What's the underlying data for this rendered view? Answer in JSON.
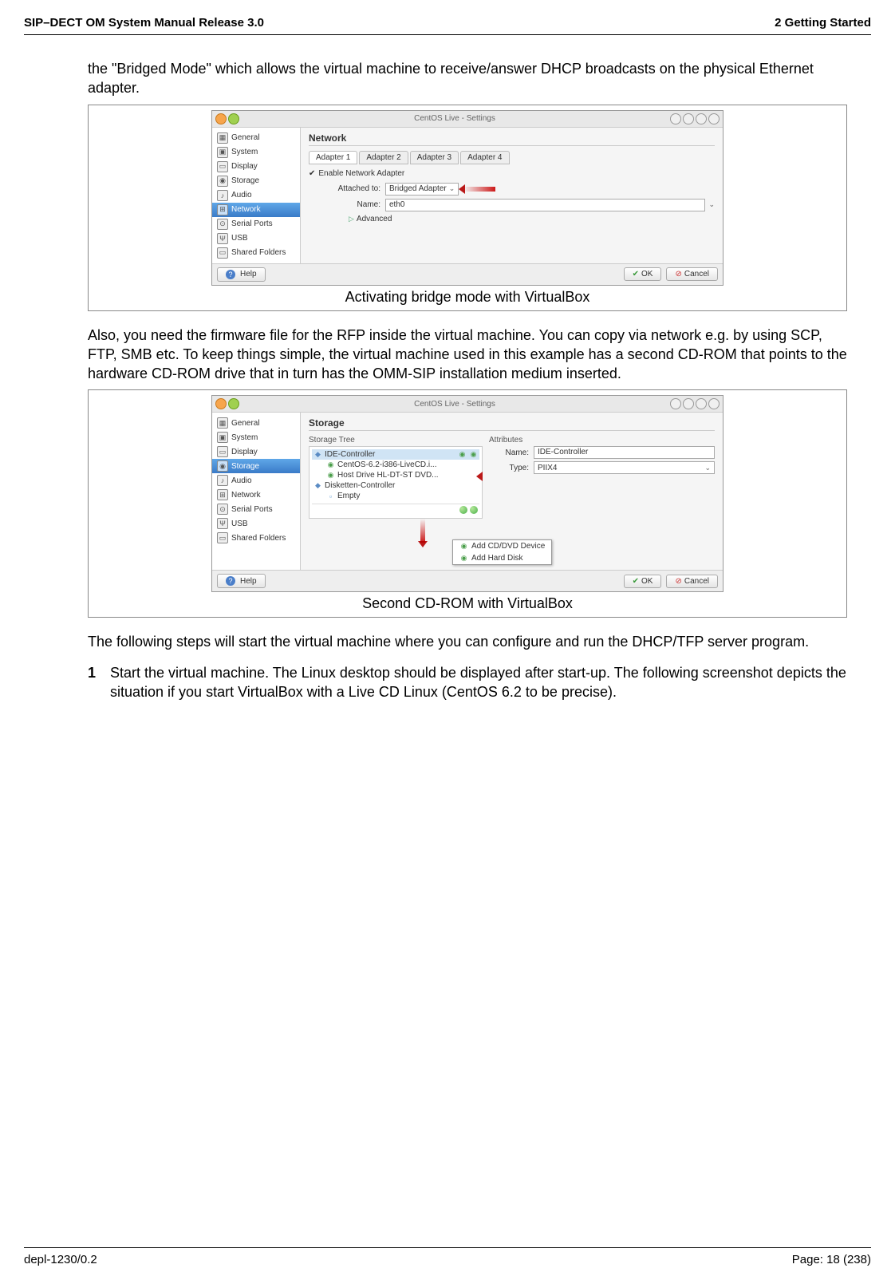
{
  "headerLeft": "SIP–DECT OM System Manual Release 3.0",
  "headerRight": "2 Getting Started",
  "para1": "the \"Bridged Mode\" which allows the virtual machine to receive/answer DHCP broadcasts on the physical Ethernet adapter.",
  "fig1": {
    "title": "CentOS Live - Settings",
    "sidebar": [
      "General",
      "System",
      "Display",
      "Storage",
      "Audio",
      "Network",
      "Serial Ports",
      "USB",
      "Shared Folders"
    ],
    "selectedIndex": 5,
    "mainTitle": "Network",
    "tabs": [
      "Adapter 1",
      "Adapter 2",
      "Adapter 3",
      "Adapter 4"
    ],
    "enableAdapter": "Enable Network Adapter",
    "attachedToLabel": "Attached to:",
    "attachedToValue": "Bridged Adapter",
    "nameLabel": "Name:",
    "nameValue": "eth0",
    "advanced": "Advanced",
    "help": "Help",
    "ok": "OK",
    "cancel": "Cancel",
    "caption": "Activating bridge mode with VirtualBox"
  },
  "para2": "Also, you need the firmware file for the RFP inside the virtual machine. You can copy via network e.g. by using SCP, FTP, SMB etc. To keep things simple, the virtual machine used in this example has a second CD-ROM that points to the hardware CD-ROM drive that in turn has the OMM-SIP installation medium inserted.",
  "fig2": {
    "title": "CentOS Live - Settings",
    "sidebar": [
      "General",
      "System",
      "Display",
      "Storage",
      "Audio",
      "Network",
      "Serial Ports",
      "USB",
      "Shared Folders"
    ],
    "selectedIndex": 3,
    "mainTitle": "Storage",
    "storageTreeLabel": "Storage Tree",
    "attributesLabel": "Attributes",
    "tree": {
      "ideController": "IDE-Controller",
      "centos": "CentOS-6.2-i386-LiveCD.i...",
      "hostDrive": "Host Drive HL-DT-ST DVD...",
      "diskController": "Disketten-Controller",
      "empty": "Empty"
    },
    "attrNameLabel": "Name:",
    "attrNameValue": "IDE-Controller",
    "attrTypeLabel": "Type:",
    "attrTypeValue": "PIIX4",
    "popup1": "Add CD/DVD Device",
    "popup2": "Add Hard Disk",
    "help": "Help",
    "ok": "OK",
    "cancel": "Cancel",
    "caption": "Second CD-ROM with VirtualBox"
  },
  "para3": "The following steps will start the virtual machine where you can configure and run the DHCP/TFP server program.",
  "step1num": "1",
  "step1": "Start the virtual machine. The Linux desktop should be displayed after start-up. The following screenshot depicts the situation if you start VirtualBox with a Live CD Linux (CentOS 6.2 to be precise).",
  "footerLeft": "depl-1230/0.2",
  "footerRight": "Page: 18 (238)"
}
